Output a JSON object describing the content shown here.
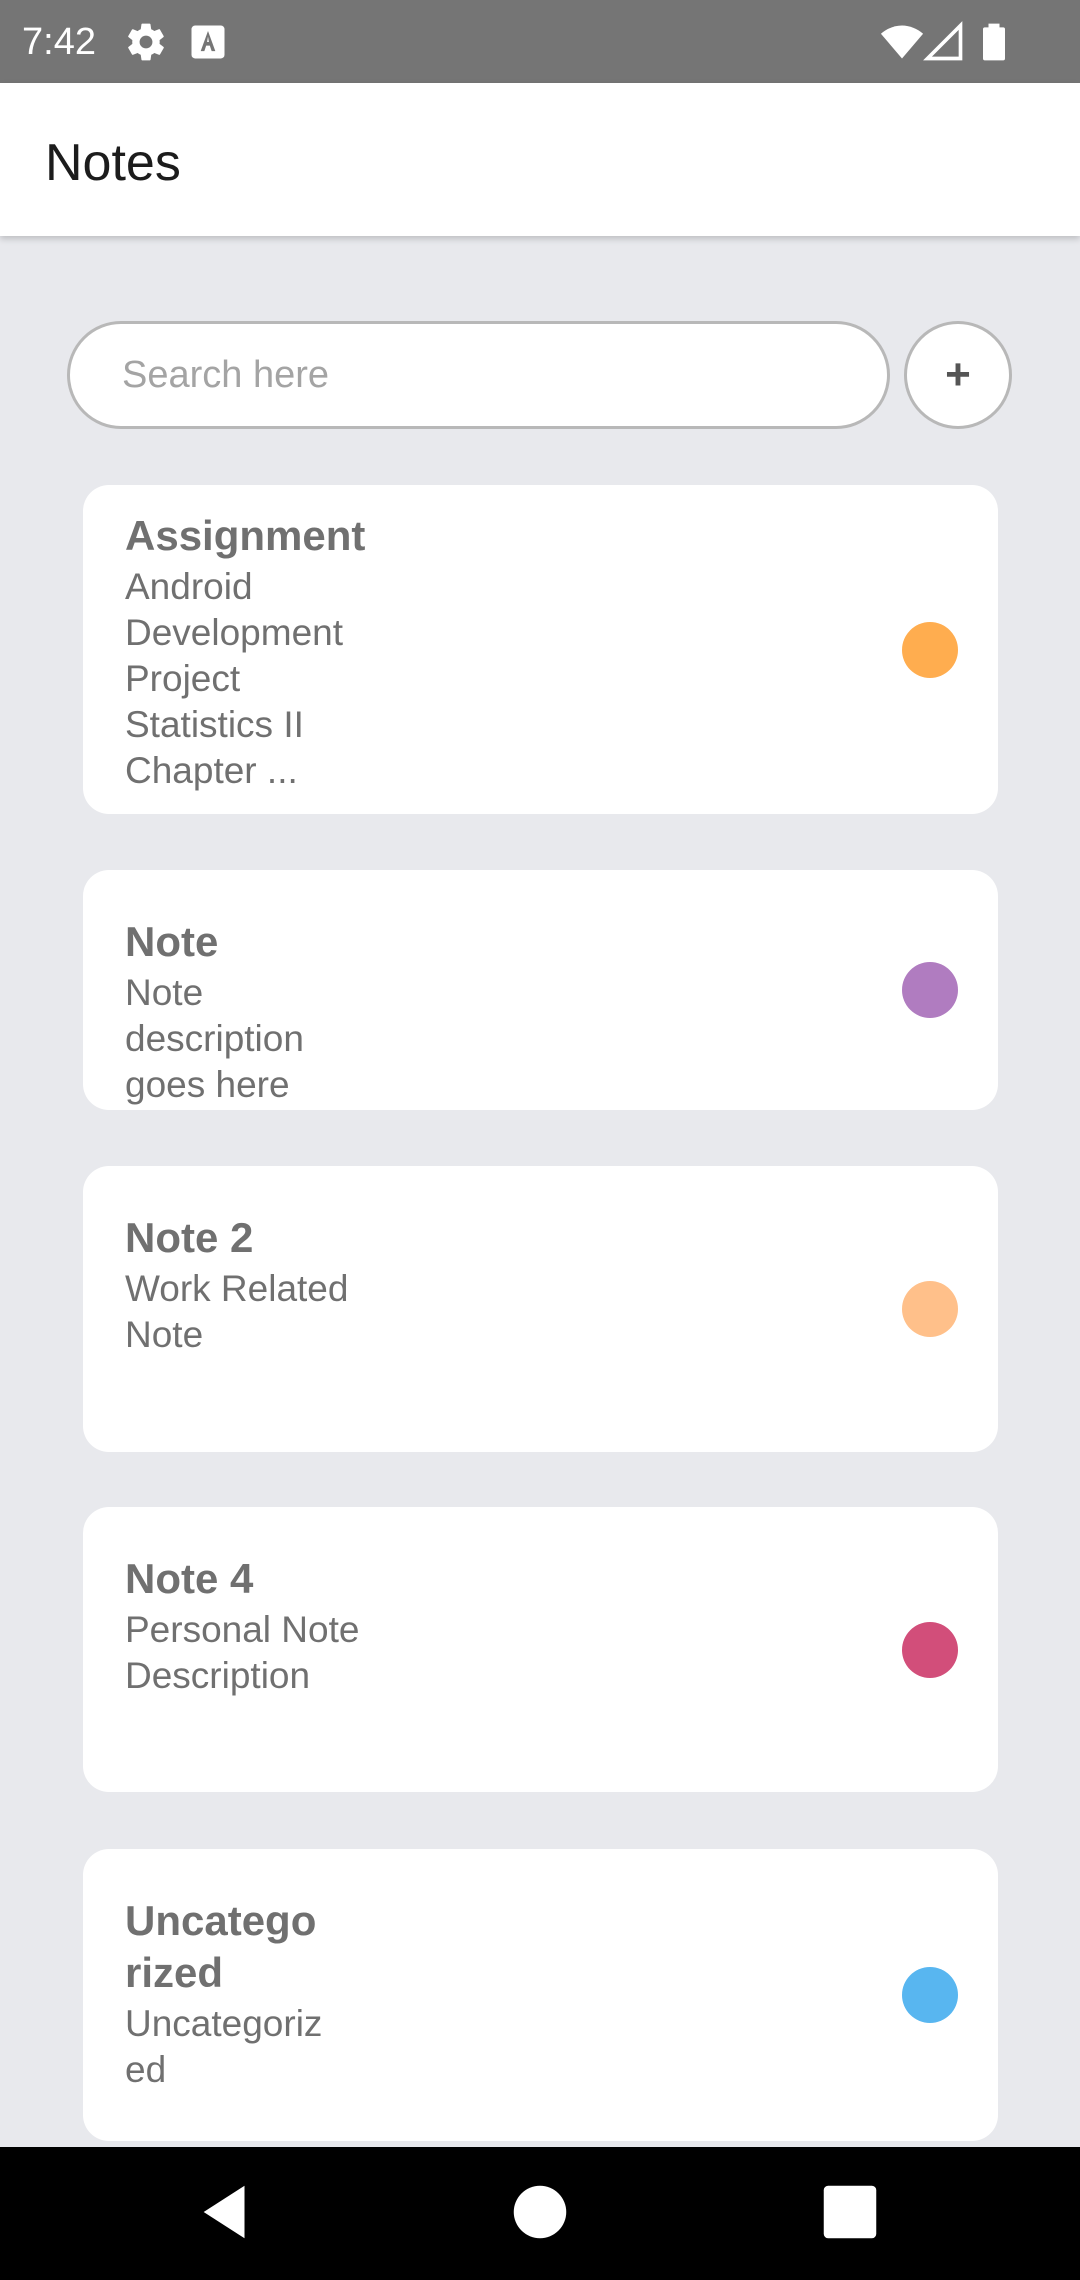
{
  "status_bar": {
    "time": "7:42",
    "icons": [
      "gear-icon",
      "text-a-icon",
      "wifi-icon",
      "signal-icon",
      "battery-icon"
    ]
  },
  "app_bar": {
    "title": "Notes"
  },
  "search": {
    "placeholder": "Search here",
    "value": ""
  },
  "add_button": {
    "label": "+"
  },
  "notes": [
    {
      "title": "Assignment",
      "description": "Android Development Project Statistics II Chapter ...",
      "color": "#ffad4f"
    },
    {
      "title": "Note",
      "description": "Note  description goes here",
      "color": "#b07cc0"
    },
    {
      "title": "Note 2",
      "description": "Work Related Note",
      "color": "#ffc08a"
    },
    {
      "title": "Note 4",
      "description": "Personal Note Description",
      "color": "#d24e7a"
    },
    {
      "title": "Uncatego rized",
      "description": "Uncategoriz ed",
      "color": "#58b6f0"
    }
  ],
  "nav_bar": {
    "buttons": [
      "back-icon",
      "home-icon",
      "recents-icon"
    ]
  },
  "colors": {
    "status_bar": "#757575",
    "background": "#e8e9ed",
    "card": "#ffffff",
    "text": "#707070"
  }
}
